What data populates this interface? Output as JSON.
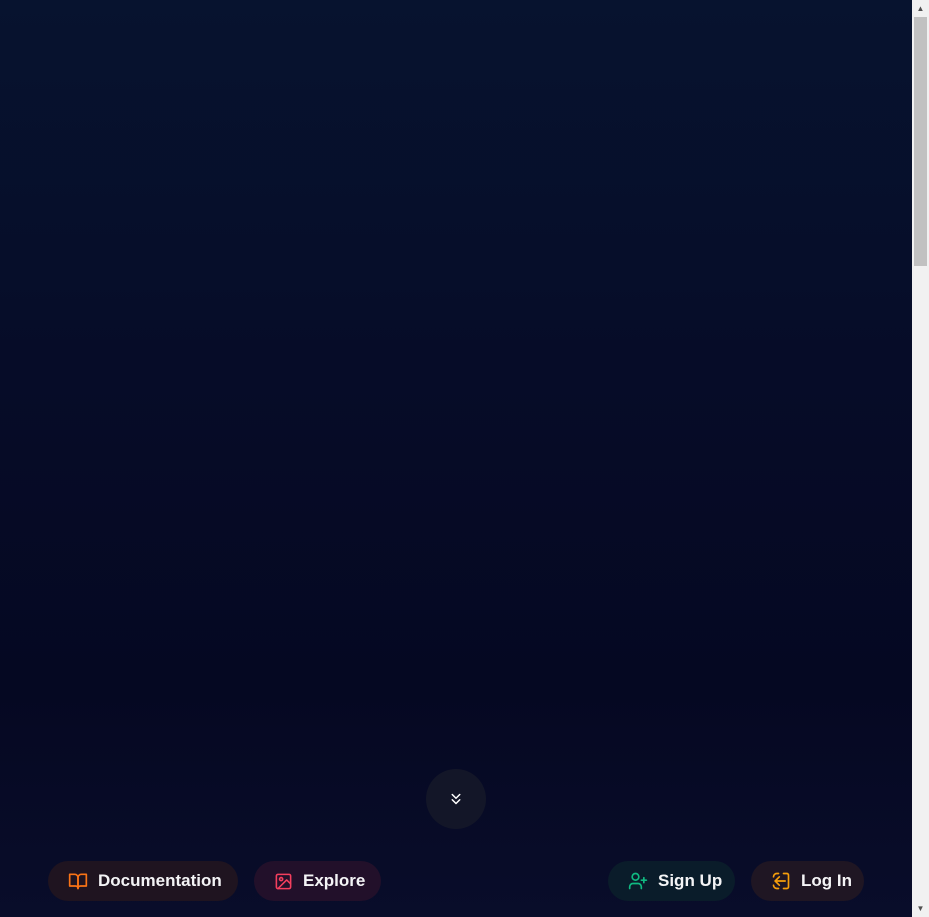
{
  "nav": {
    "left": [
      {
        "label": "Documentation",
        "icon": "book-icon",
        "accent": "#f97316"
      },
      {
        "label": "Explore",
        "icon": "image-icon",
        "accent": "#f43f5e"
      }
    ],
    "right": [
      {
        "label": "Sign Up",
        "icon": "user-plus-icon",
        "accent": "#10b981"
      },
      {
        "label": "Log In",
        "icon": "log-in-icon",
        "accent": "#f59e0b"
      }
    ]
  },
  "scroll_button": {
    "icon": "chevrons-down-icon"
  },
  "colors": {
    "background_top": "#07132f",
    "background_bottom": "#050822",
    "text": "#f4f4f6"
  }
}
